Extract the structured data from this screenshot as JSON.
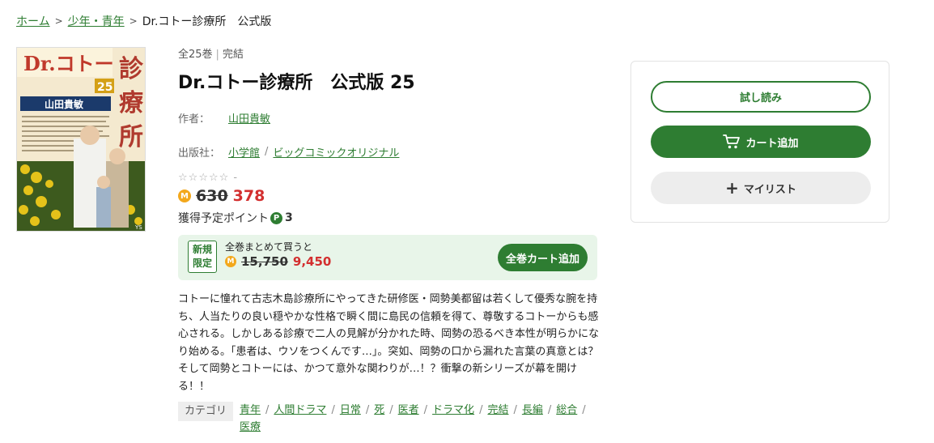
{
  "breadcrumb": {
    "home": "ホーム",
    "category": "少年・青年",
    "current": "Dr.コトー診療所　公式版"
  },
  "cover": {
    "title_art": "Dr.コトー診療所",
    "volume_art": "25",
    "author_art": "山田貴敏",
    "icon": "book-cover-image"
  },
  "product": {
    "volumes": "全25巻",
    "status": "完結",
    "title": "Dr.コトー診療所　公式版 25",
    "author_label": "作者：",
    "author": "山田貴敏",
    "publisher_label": "出版社：",
    "publisher": "小学館",
    "label_brand": "ビッグコミックオリジナル",
    "rating_text": "-",
    "star_count": 5,
    "original_price": "630",
    "sale_price": "378",
    "points_label": "獲得予定ポイント",
    "points_value": "3"
  },
  "bundle": {
    "tag_line1": "新規",
    "tag_line2": "限定",
    "title": "全巻まとめて買うと",
    "original_price": "15,750",
    "sale_price": "9,450",
    "button": "全巻カート追加"
  },
  "description": "コトーに憧れて古志木島診療所にやってきた研修医・岡勢美都留は若くして優秀な腕を持ち、人当たりの良い穏やかな性格で瞬く間に島民の信頼を得て、尊敬するコトーからも感心される。しかしある診療で二人の見解が分かれた時、岡勢の恐るべき本性が明らかになり始める。「患者は、ウソをつくんです…」。突如、岡勢の口から漏れた言葉の真意とは？そして岡勢とコトーには、かつて意外な関わりが…！？衝撃の新シリーズが幕を開ける！！",
  "categories": {
    "label": "カテゴリ",
    "items": [
      "青年",
      "人間ドラマ",
      "日常",
      "死",
      "医者",
      "ドラマ化",
      "完結",
      "長編",
      "総合",
      "医療"
    ]
  },
  "actions": {
    "trial": "試し読み",
    "cart": "カート追加",
    "mylist": "マイリスト"
  },
  "colors": {
    "accent": "#2e7d32",
    "price": "#d32f2f",
    "coin": "#f3a81c",
    "bundle_bg": "#e8f5e9"
  }
}
